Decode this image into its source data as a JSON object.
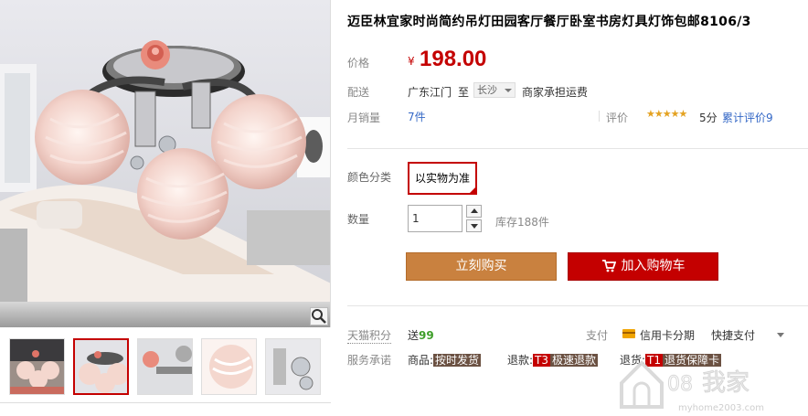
{
  "product": {
    "title": "迈臣林宜家时尚简约吊灯田园客厅餐厅卧室书房灯具灯饰包邮8106/3"
  },
  "price": {
    "label": "价格",
    "currency": "¥",
    "value": "198.00",
    "color": "#c40000"
  },
  "shipping": {
    "label": "配送",
    "from": "广东江门",
    "to_word": "至",
    "city": "长沙",
    "note": "商家承担运费"
  },
  "sales": {
    "label": "月销量",
    "count": "7件",
    "rating_label": "评价",
    "stars": "★★★★★",
    "score": "5分",
    "reviews": "累计评价9"
  },
  "sku": {
    "label": "颜色分类",
    "option": "以实物为准"
  },
  "quantity": {
    "label": "数量",
    "value": "1",
    "stock": "库存188件"
  },
  "actions": {
    "buy": "立刻购买",
    "cart": "加入购物车",
    "buy_color": "#c9813f",
    "cart_color": "#c40000"
  },
  "points": {
    "label": "天猫积分",
    "prefix": "送",
    "value": "99"
  },
  "payment": {
    "label": "支付",
    "credit": "信用卡分期",
    "quick": "快捷支付"
  },
  "service": {
    "label": "服务承诺",
    "goods_prefix": "商品:",
    "goods_tag": "按时发货",
    "refund_prefix": "退款:",
    "refund_badge": "T3",
    "refund_tag": "极速退款",
    "return_prefix": "退货:",
    "return_badge": "T1",
    "return_tag": "退货保障卡"
  },
  "watermark": {
    "brand": "我家",
    "url": "myhome2003.com"
  }
}
